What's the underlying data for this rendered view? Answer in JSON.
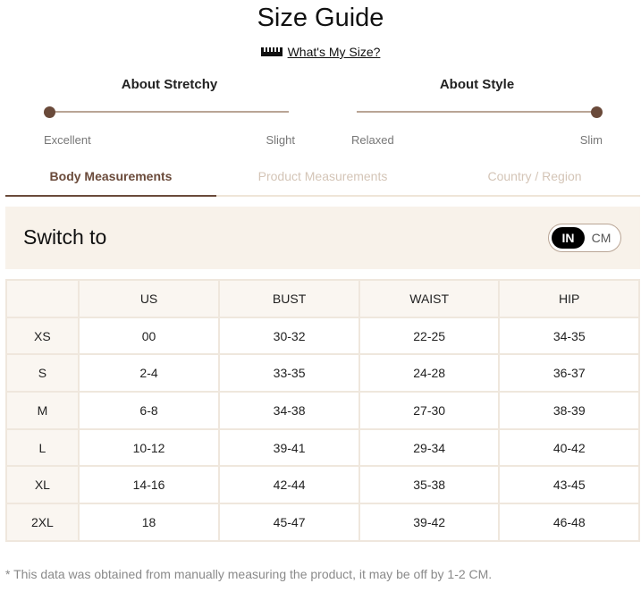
{
  "title": "Size Guide",
  "size_link": {
    "label": "What's My Size?",
    "icon": "ruler-icon"
  },
  "scales": [
    {
      "title": "About Stretchy",
      "left_label": "Excellent",
      "right_label": "Slight"
    },
    {
      "title": "About Style",
      "left_label": "Relaxed",
      "right_label": "Slim"
    }
  ],
  "tabs": [
    {
      "label": "Body Measurements",
      "active": true
    },
    {
      "label": "Product Measurements",
      "active": false
    },
    {
      "label": "Country / Region",
      "active": false
    }
  ],
  "switch": {
    "label": "Switch to",
    "options": [
      "IN",
      "CM"
    ],
    "selected": "IN"
  },
  "table": {
    "headers": [
      "",
      "US",
      "BUST",
      "WAIST",
      "HIP"
    ],
    "rows": [
      [
        "XS",
        "00",
        "30-32",
        "22-25",
        "34-35"
      ],
      [
        "S",
        "2-4",
        "33-35",
        "24-28",
        "36-37"
      ],
      [
        "M",
        "6-8",
        "34-38",
        "27-30",
        "38-39"
      ],
      [
        "L",
        "10-12",
        "39-41",
        "29-34",
        "40-42"
      ],
      [
        "XL",
        "14-16",
        "42-44",
        "35-38",
        "43-45"
      ],
      [
        "2XL",
        "18",
        "45-47",
        "39-42",
        "46-48"
      ]
    ]
  },
  "footnote": "* This data was obtained from manually measuring the product, it may be off by 1-2 CM.",
  "colors": {
    "accent": "#6a4a3a",
    "panel": "#f8f2ea",
    "inactive_tab": "#d4c5b7"
  }
}
